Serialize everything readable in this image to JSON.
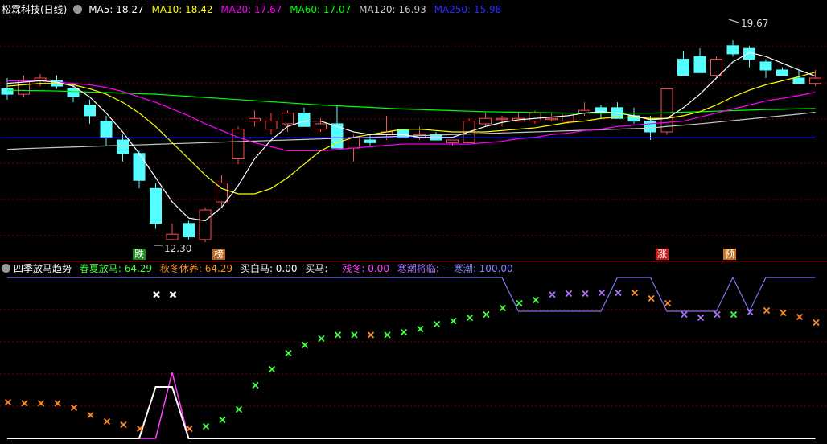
{
  "header": {
    "title": "松霖科技(日线)",
    "ma": [
      {
        "label": "MA5: 18.27",
        "color": "#ffffff"
      },
      {
        "label": "MA10: 18.42",
        "color": "#ffff00"
      },
      {
        "label": "MA20: 17.67",
        "color": "#ff00ff"
      },
      {
        "label": "MA60: 17.07",
        "color": "#00ff00"
      },
      {
        "label": "MA120: 16.93",
        "color": "#c8c8c8"
      },
      {
        "label": "MA250: 15.98",
        "color": "#2a2aff"
      }
    ]
  },
  "indicator_header": {
    "title": "四季放马趋势",
    "items": [
      {
        "label": "春夏放马: 64.29",
        "color": "#44ff44"
      },
      {
        "label": "秋冬休养: 64.29",
        "color": "#ff8c28"
      },
      {
        "label": "买白马: 0.00",
        "color": "#ffffff"
      },
      {
        "label": "买马: -",
        "color": "#ffffff"
      },
      {
        "label": "残冬: 0.00",
        "color": "#ff44ff"
      },
      {
        "label": "寒潮将临: -",
        "color": "#aa77ff"
      },
      {
        "label": "寒潮: 100.00",
        "color": "#8888ff"
      }
    ]
  },
  "annotations": {
    "high": "19.67",
    "low": "12.30",
    "tags": [
      {
        "text": "跌",
        "bg": "#1c8a1c"
      },
      {
        "text": "榜",
        "bg": "#b4641e"
      },
      {
        "text": "涨",
        "bg": "#c81e1e"
      },
      {
        "text": "预",
        "bg": "#c8781e"
      }
    ]
  },
  "colors": {
    "up": "#ff4d4d",
    "down": "#55ffff",
    "grid": "#7a0000",
    "ma5": "#ffffff",
    "ma10": "#ffff00",
    "ma20": "#ff00ff",
    "ma60": "#00ff00",
    "ma120": "#c8c8c8",
    "ma250": "#2a2aff"
  },
  "chart_data": {
    "type": "candlestick",
    "ohlc": [
      [
        17.8,
        18.2,
        17.4,
        17.6
      ],
      [
        17.6,
        18.3,
        17.5,
        18.1
      ],
      [
        18.1,
        18.35,
        17.9,
        18.2
      ],
      [
        18.1,
        18.3,
        17.8,
        17.9
      ],
      [
        17.8,
        18.0,
        17.3,
        17.5
      ],
      [
        17.2,
        17.4,
        16.5,
        16.8
      ],
      [
        16.6,
        16.8,
        15.7,
        16.0
      ],
      [
        15.9,
        16.1,
        15.1,
        15.4
      ],
      [
        15.4,
        15.5,
        14.1,
        14.4
      ],
      [
        14.1,
        14.3,
        12.6,
        12.8
      ],
      [
        12.2,
        12.8,
        12.3,
        12.4
      ],
      [
        12.8,
        12.9,
        12.2,
        12.3
      ],
      [
        12.2,
        13.4,
        12.1,
        13.3
      ],
      [
        13.6,
        14.6,
        13.4,
        14.3
      ],
      [
        15.2,
        16.4,
        15.0,
        16.3
      ],
      [
        16.6,
        17.0,
        16.4,
        16.7
      ],
      [
        16.3,
        16.9,
        16.1,
        16.6
      ],
      [
        16.5,
        17.0,
        16.2,
        16.9
      ],
      [
        16.9,
        17.1,
        16.5,
        16.4
      ],
      [
        16.3,
        16.7,
        16.2,
        16.5
      ],
      [
        16.5,
        17.2,
        16.0,
        15.6
      ],
      [
        15.6,
        16.1,
        15.1,
        16.0
      ],
      [
        15.9,
        16.1,
        15.7,
        15.8
      ],
      [
        16.1,
        16.8,
        15.9,
        16.2
      ],
      [
        16.3,
        16.3,
        16.0,
        16.0
      ],
      [
        16.0,
        16.4,
        15.9,
        16.1
      ],
      [
        16.1,
        16.2,
        15.9,
        15.9
      ],
      [
        15.8,
        15.9,
        15.7,
        15.9
      ],
      [
        15.8,
        16.7,
        15.8,
        16.6
      ],
      [
        16.5,
        16.9,
        16.4,
        16.7
      ],
      [
        16.7,
        16.8,
        16.4,
        16.7
      ],
      [
        16.6,
        16.9,
        16.6,
        16.7
      ],
      [
        16.6,
        17.0,
        16.5,
        16.9
      ],
      [
        16.7,
        16.9,
        16.6,
        16.7
      ],
      [
        16.6,
        16.9,
        16.5,
        16.9
      ],
      [
        16.9,
        17.3,
        16.8,
        17.0
      ],
      [
        17.1,
        17.2,
        16.7,
        16.9
      ],
      [
        17.1,
        17.3,
        16.8,
        16.7
      ],
      [
        16.8,
        17.1,
        16.5,
        16.6
      ],
      [
        16.6,
        16.8,
        15.9,
        16.2
      ],
      [
        16.2,
        17.6,
        16.1,
        17.8
      ],
      [
        18.9,
        19.2,
        18.7,
        18.3
      ],
      [
        19.0,
        19.3,
        18.5,
        18.4
      ],
      [
        18.3,
        19.0,
        18.2,
        18.9
      ],
      [
        19.4,
        19.6,
        19.0,
        19.1
      ],
      [
        19.3,
        19.4,
        18.6,
        18.9
      ],
      [
        18.8,
        18.9,
        18.2,
        18.5
      ],
      [
        18.5,
        18.6,
        18.3,
        18.3
      ],
      [
        18.2,
        18.5,
        18.0,
        18.0
      ],
      [
        18.0,
        18.5,
        17.9,
        18.2
      ]
    ],
    "ma": {
      "ma5": [
        18.0,
        18.05,
        18.1,
        18.05,
        17.9,
        17.5,
        16.9,
        16.2,
        15.4,
        14.5,
        13.6,
        13.0,
        12.9,
        13.4,
        14.2,
        15.2,
        15.9,
        16.4,
        16.6,
        16.6,
        16.4,
        16.2,
        16.1,
        16.1,
        16.1,
        16.0,
        16.0,
        16.0,
        16.2,
        16.4,
        16.55,
        16.65,
        16.7,
        16.75,
        16.8,
        16.9,
        16.95,
        16.9,
        16.8,
        16.65,
        16.7,
        17.1,
        17.6,
        18.2,
        18.8,
        19.15,
        19.0,
        18.75,
        18.5,
        18.27
      ],
      "ma10": [
        17.9,
        17.95,
        18.0,
        18.0,
        17.95,
        17.8,
        17.6,
        17.3,
        16.9,
        16.4,
        15.8,
        15.2,
        14.6,
        14.1,
        13.9,
        13.9,
        14.1,
        14.5,
        15.0,
        15.5,
        15.8,
        16.0,
        16.1,
        16.2,
        16.3,
        16.3,
        16.25,
        16.2,
        16.2,
        16.2,
        16.25,
        16.3,
        16.35,
        16.45,
        16.55,
        16.6,
        16.7,
        16.75,
        16.75,
        16.7,
        16.7,
        16.8,
        16.95,
        17.2,
        17.5,
        17.75,
        17.95,
        18.1,
        18.25,
        18.42
      ],
      "ma20": [
        18.1,
        18.1,
        18.1,
        18.05,
        18.0,
        17.95,
        17.85,
        17.7,
        17.5,
        17.3,
        17.05,
        16.8,
        16.5,
        16.25,
        16.0,
        15.8,
        15.65,
        15.5,
        15.5,
        15.5,
        15.55,
        15.6,
        15.65,
        15.7,
        15.75,
        15.75,
        15.75,
        15.75,
        15.75,
        15.8,
        15.85,
        15.95,
        16.0,
        16.1,
        16.15,
        16.25,
        16.3,
        16.4,
        16.45,
        16.5,
        16.55,
        16.6,
        16.75,
        16.9,
        17.05,
        17.2,
        17.35,
        17.45,
        17.55,
        17.67
      ],
      "ma60": [
        17.75,
        17.74,
        17.73,
        17.72,
        17.7,
        17.68,
        17.66,
        17.64,
        17.62,
        17.6,
        17.56,
        17.52,
        17.48,
        17.44,
        17.4,
        17.36,
        17.32,
        17.28,
        17.24,
        17.2,
        17.17,
        17.14,
        17.11,
        17.08,
        17.05,
        17.03,
        17.01,
        16.99,
        16.97,
        16.95,
        16.94,
        16.93,
        16.92,
        16.91,
        16.9,
        16.9,
        16.9,
        16.9,
        16.9,
        16.9,
        16.91,
        16.93,
        16.95,
        16.97,
        16.99,
        17.01,
        17.03,
        17.04,
        17.06,
        17.07
      ],
      "ma120": [
        15.55,
        15.58,
        15.6,
        15.62,
        15.64,
        15.66,
        15.68,
        15.7,
        15.72,
        15.74,
        15.76,
        15.78,
        15.8,
        15.82,
        15.84,
        15.86,
        15.88,
        15.9,
        15.92,
        15.94,
        15.96,
        15.98,
        16.0,
        16.02,
        16.04,
        16.06,
        16.08,
        16.1,
        16.12,
        16.14,
        16.16,
        16.18,
        16.2,
        16.22,
        16.24,
        16.26,
        16.28,
        16.3,
        16.32,
        16.34,
        16.4,
        16.45,
        16.5,
        16.56,
        16.62,
        16.68,
        16.74,
        16.8,
        16.86,
        16.93
      ],
      "ma250": [
        15.98,
        15.98,
        15.98,
        15.98,
        15.98,
        15.98,
        15.98,
        15.98,
        15.98,
        15.98,
        15.98,
        15.98,
        15.98,
        15.98,
        15.98,
        15.98,
        15.98,
        15.98,
        15.98,
        15.98,
        15.98,
        15.98,
        15.98,
        15.98,
        15.98,
        15.98,
        15.98,
        15.98,
        15.98,
        15.98,
        15.98,
        15.98,
        15.98,
        15.98,
        15.98,
        15.98,
        15.98,
        15.98,
        15.98,
        15.98,
        15.98,
        15.98,
        15.98,
        15.98,
        15.98,
        15.98,
        15.98,
        15.98,
        15.98,
        15.98
      ]
    },
    "price_range": [
      11.6,
      20.5
    ],
    "indicator": {
      "range": [
        0,
        100
      ],
      "markers": [
        [
          22.5,
          "orange"
        ],
        [
          21.8,
          "orange"
        ],
        [
          21.8,
          "orange"
        ],
        [
          21.8,
          "orange"
        ],
        [
          19.0,
          "orange"
        ],
        [
          14.5,
          "orange"
        ],
        [
          10.5,
          "orange"
        ],
        [
          8.5,
          "orange"
        ],
        [
          6.0,
          "orange"
        ],
        [
          89.4,
          "white"
        ],
        [
          89.4,
          "white"
        ],
        [
          6.0,
          "orange"
        ],
        [
          7.5,
          "green"
        ],
        [
          11.5,
          "green"
        ],
        [
          18.0,
          "green"
        ],
        [
          33.0,
          "green"
        ],
        [
          43.0,
          "green"
        ],
        [
          53.0,
          "green"
        ],
        [
          58.0,
          "green"
        ],
        [
          62.0,
          "green"
        ],
        [
          64.29,
          "green"
        ],
        [
          64.29,
          "green"
        ],
        [
          64.29,
          "orange"
        ],
        [
          64.29,
          "green"
        ],
        [
          66.0,
          "green"
        ],
        [
          68.0,
          "green"
        ],
        [
          71.0,
          "green"
        ],
        [
          73.0,
          "green"
        ],
        [
          75.0,
          "green"
        ],
        [
          77.0,
          "green"
        ],
        [
          81.0,
          "green"
        ],
        [
          84.0,
          "green"
        ],
        [
          86.0,
          "green"
        ],
        [
          89.4,
          "violet"
        ],
        [
          90.0,
          "violet"
        ],
        [
          90.0,
          "violet"
        ],
        [
          90.5,
          "violet"
        ],
        [
          90.5,
          "violet"
        ],
        [
          90.5,
          "orange"
        ],
        [
          87.0,
          "orange"
        ],
        [
          84.0,
          "orange"
        ],
        [
          77.0,
          "violet"
        ],
        [
          75.0,
          "violet"
        ],
        [
          77.0,
          "violet"
        ],
        [
          77.0,
          "green"
        ],
        [
          78.5,
          "violet"
        ],
        [
          79.5,
          "orange"
        ],
        [
          78.0,
          "orange"
        ],
        [
          75.5,
          "orange"
        ],
        [
          72.0,
          "orange"
        ]
      ],
      "cold_line": [
        100,
        100,
        100,
        100,
        100,
        100,
        100,
        100,
        100,
        100,
        100,
        100,
        100,
        100,
        100,
        100,
        100,
        100,
        100,
        100,
        100,
        100,
        100,
        100,
        100,
        100,
        100,
        100,
        100,
        100,
        100,
        79,
        79,
        79,
        79,
        79,
        79,
        100,
        100,
        100,
        79,
        79,
        79,
        79,
        100,
        79,
        100,
        100,
        100,
        100
      ],
      "white_line": [
        0,
        0,
        0,
        0,
        0,
        0,
        0,
        0,
        0,
        32,
        32,
        0,
        0,
        0,
        0,
        0,
        0,
        0,
        0,
        0,
        0,
        0,
        0,
        0,
        0,
        0,
        0,
        0,
        0,
        0,
        0,
        0,
        0,
        0,
        0,
        0,
        0,
        0,
        0,
        0,
        0,
        0,
        0,
        0,
        0,
        0,
        0,
        0,
        0,
        0
      ],
      "magenta_line": [
        0,
        0,
        0,
        0,
        0,
        0,
        0,
        0,
        0,
        0,
        41,
        0,
        0,
        0,
        0,
        0,
        0,
        0,
        0,
        0,
        0,
        0,
        0,
        0,
        0,
        0,
        0,
        0,
        0,
        0,
        0,
        0,
        0,
        0,
        0,
        0,
        0,
        0,
        0,
        0,
        0,
        0,
        0,
        0,
        0,
        0,
        0,
        0,
        0,
        0
      ]
    }
  }
}
